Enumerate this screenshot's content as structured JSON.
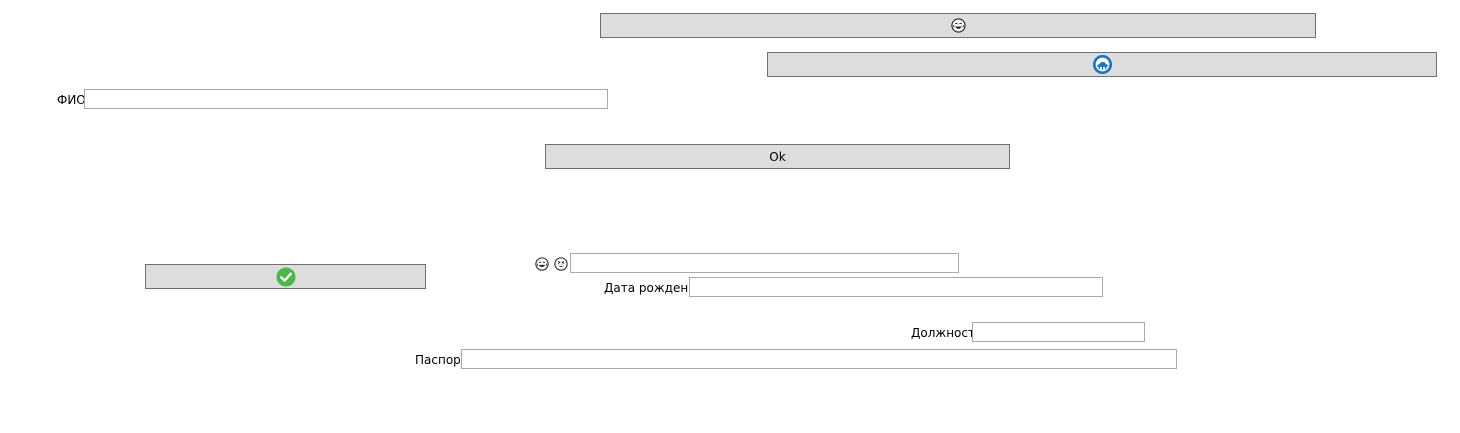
{
  "buttons": {
    "laugh_button_icon": "face-with-tears-of-joy-icon",
    "blue_button_icon": "blue-cloud-badge-icon",
    "ok_label": "Ok",
    "check_button_icon": "green-check-circle-icon"
  },
  "form": {
    "fio_label": "ФИО",
    "fio_value": "",
    "emoji_field_icons": [
      "face-with-tears-of-joy-icon",
      "grinning-squinting-face-icon"
    ],
    "emoji_field_value": "",
    "birth_label": "Дата рождения",
    "birth_value": "",
    "position_label": "Должность",
    "position_value": "",
    "passport_label": "Паспорт",
    "passport_value": ""
  },
  "colors": {
    "button_bg": "#dddddd",
    "button_border": "#707070",
    "field_border": "#a9a9a9",
    "accent_blue": "#1a73c8",
    "accent_green": "#4cb848"
  }
}
